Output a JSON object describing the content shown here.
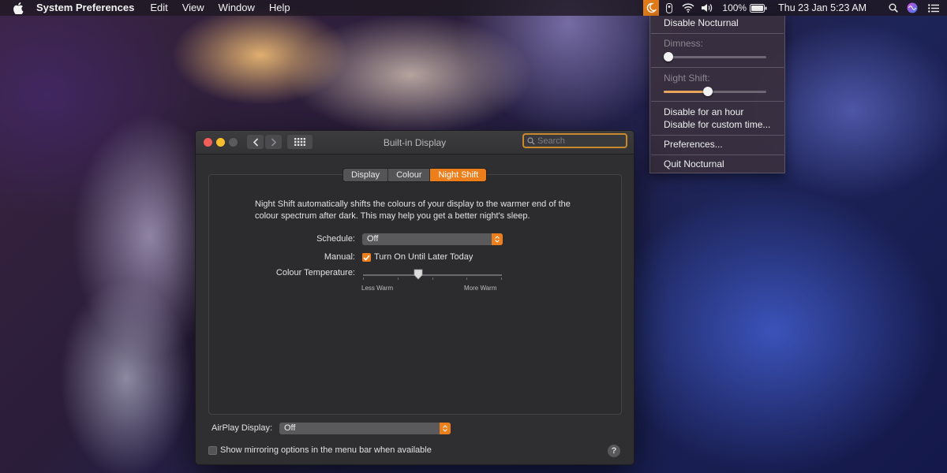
{
  "menubar": {
    "app_name": "System Preferences",
    "menus": [
      "Edit",
      "View",
      "Window",
      "Help"
    ],
    "battery": "100%",
    "datetime": "Thu 23 Jan  5:23 AM",
    "icons": [
      "apple-icon",
      "nocturnal-icon",
      "flashlight-icon",
      "wifi-icon",
      "volume-icon",
      "battery-icon",
      "spotlight-icon",
      "siri-icon",
      "list-icon"
    ]
  },
  "dropdown": {
    "disable": "Disable Nocturnal",
    "dimness_label": "Dimness:",
    "dimness_value": 0,
    "night_shift_label": "Night Shift:",
    "night_shift_value": 0.42,
    "disable_hour": "Disable for an hour",
    "disable_custom": "Disable for custom time...",
    "preferences": "Preferences...",
    "quit": "Quit Nocturnal"
  },
  "window": {
    "title": "Built-in Display",
    "search_placeholder": "Search",
    "tabs": [
      "Display",
      "Colour",
      "Night Shift"
    ],
    "active_tab": "Night Shift",
    "description": "Night Shift automatically shifts the colours of your display to the warmer end of the colour spectrum after dark. This may help you get a better night's sleep.",
    "schedule_label": "Schedule:",
    "schedule_value": "Off",
    "manual_label": "Manual:",
    "manual_checkbox_label": "Turn On Until Later Today",
    "manual_checked": true,
    "temperature_label": "Colour Temperature:",
    "temperature_value": 0.4,
    "less_warm": "Less Warm",
    "more_warm": "More Warm",
    "airplay_label": "AirPlay Display:",
    "airplay_value": "Off",
    "mirroring_label": "Show mirroring options in the menu bar when available",
    "mirroring_checked": false,
    "help": "?"
  },
  "colors": {
    "accent": "#ec7f1c",
    "window_bg": "#2f2f31",
    "close": "#f25f58",
    "minimize": "#f9be2e"
  }
}
